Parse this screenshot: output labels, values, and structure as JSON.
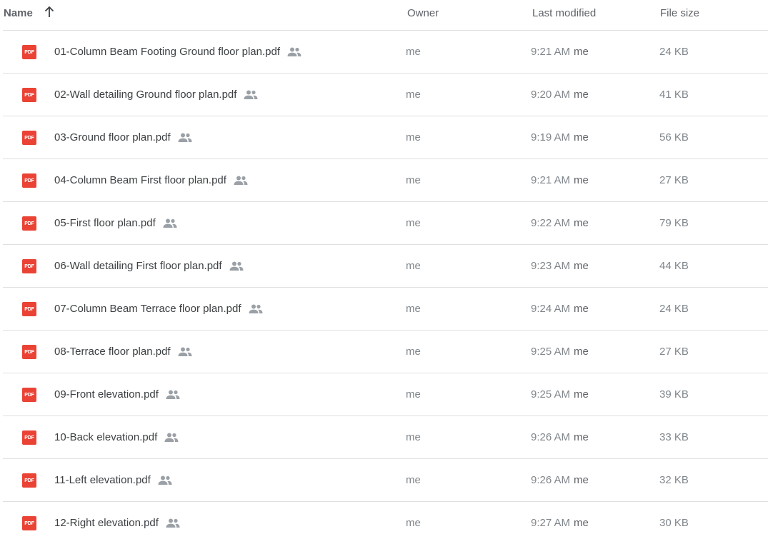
{
  "columns": {
    "name": "Name",
    "owner": "Owner",
    "last_modified": "Last modified",
    "file_size": "File size"
  },
  "sort_icon": "arrow-up-icon",
  "file_icon": {
    "label": "PDF",
    "color": "#ea4335"
  },
  "shared_icon": "people-icon",
  "files": [
    {
      "name": "01-Column Beam Footing Ground floor plan.pdf",
      "owner": "me",
      "modified_time": "9:21 AM",
      "modified_by": "me",
      "size": "24 KB"
    },
    {
      "name": "02-Wall detailing Ground floor plan.pdf",
      "owner": "me",
      "modified_time": "9:20 AM",
      "modified_by": "me",
      "size": "41 KB"
    },
    {
      "name": "03-Ground floor plan.pdf",
      "owner": "me",
      "modified_time": "9:19 AM",
      "modified_by": "me",
      "size": "56 KB"
    },
    {
      "name": "04-Column Beam First floor plan.pdf",
      "owner": "me",
      "modified_time": "9:21 AM",
      "modified_by": "me",
      "size": "27 KB"
    },
    {
      "name": "05-First floor plan.pdf",
      "owner": "me",
      "modified_time": "9:22 AM",
      "modified_by": "me",
      "size": "79 KB"
    },
    {
      "name": "06-Wall detailing First floor plan.pdf",
      "owner": "me",
      "modified_time": "9:23 AM",
      "modified_by": "me",
      "size": "44 KB"
    },
    {
      "name": "07-Column Beam Terrace floor plan.pdf",
      "owner": "me",
      "modified_time": "9:24 AM",
      "modified_by": "me",
      "size": "24 KB"
    },
    {
      "name": "08-Terrace floor plan.pdf",
      "owner": "me",
      "modified_time": "9:25 AM",
      "modified_by": "me",
      "size": "27 KB"
    },
    {
      "name": "09-Front elevation.pdf",
      "owner": "me",
      "modified_time": "9:25 AM",
      "modified_by": "me",
      "size": "39 KB"
    },
    {
      "name": "10-Back elevation.pdf",
      "owner": "me",
      "modified_time": "9:26 AM",
      "modified_by": "me",
      "size": "33 KB"
    },
    {
      "name": "11-Left elevation.pdf",
      "owner": "me",
      "modified_time": "9:26 AM",
      "modified_by": "me",
      "size": "32 KB"
    },
    {
      "name": "12-Right elevation.pdf",
      "owner": "me",
      "modified_time": "9:27 AM",
      "modified_by": "me",
      "size": "30 KB"
    }
  ]
}
